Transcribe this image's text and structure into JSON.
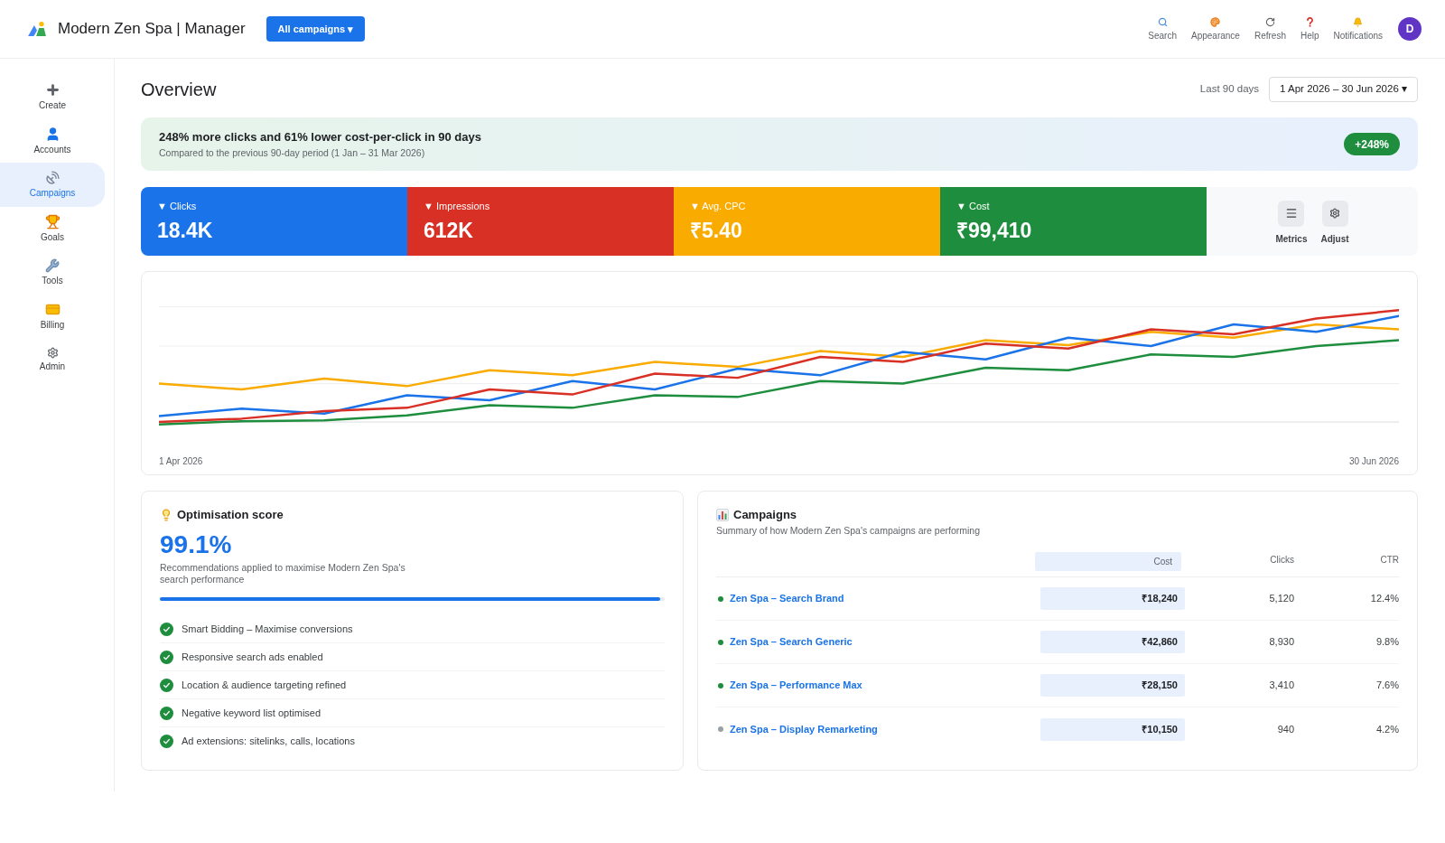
{
  "header": {
    "title": "Modern Zen Spa | Manager",
    "scope_button": "All campaigns ▾",
    "tools": [
      {
        "label": "Search"
      },
      {
        "label": "Appearance"
      },
      {
        "label": "Refresh"
      },
      {
        "label": "Help"
      },
      {
        "label": "Notifications"
      }
    ],
    "avatar": "D"
  },
  "sidebar": {
    "items": [
      {
        "label": "Create",
        "selected": false
      },
      {
        "label": "Accounts",
        "selected": false
      },
      {
        "label": "Campaigns",
        "selected": true
      },
      {
        "label": "Goals",
        "selected": false
      },
      {
        "label": "Tools",
        "selected": false
      },
      {
        "label": "Billing",
        "selected": false
      },
      {
        "label": "Admin",
        "selected": false
      }
    ]
  },
  "overview": {
    "title": "Overview",
    "range_label": "Last 90 days",
    "date_range": "1 Apr 2026 – 30 Jun 2026 ▾"
  },
  "banner": {
    "headline": "248% more clicks and 61% lower cost-per-click in 90 days",
    "subtext": "Compared to the previous 90-day period (1 Jan – 31 Mar 2026)",
    "badge": "+248%"
  },
  "metrics": [
    {
      "label": "▼ Clicks",
      "value": "18.4K",
      "color": "#1a73e8"
    },
    {
      "label": "▼ Impressions",
      "value": "612K",
      "color": "#d93025"
    },
    {
      "label": "▼ Avg. CPC",
      "value": "₹5.40",
      "color": "#f9ab00"
    },
    {
      "label": "▼ Cost",
      "value": "₹99,410",
      "color": "#1e8e3e"
    }
  ],
  "metric_actions": [
    {
      "label": "Metrics"
    },
    {
      "label": "Adjust"
    }
  ],
  "chart": {
    "start_label": "1 Apr 2026",
    "end_label": "30 Jun 2026"
  },
  "optimisation": {
    "title": "Optimisation score",
    "score": "99.1%",
    "description": "Recommendations applied to maximise Modern Zen Spa's search performance",
    "level": 0.991,
    "items": [
      {
        "label": "Smart Bidding – Maximise conversions",
        "checked": true
      },
      {
        "label": "Responsive search ads enabled",
        "checked": true
      },
      {
        "label": "Location & audience targeting refined",
        "checked": true
      },
      {
        "label": "Negative keyword list optimised",
        "checked": true
      },
      {
        "label": "Ad extensions: sitelinks, calls, locations",
        "checked": true
      }
    ]
  },
  "campaigns": {
    "title": "Campaigns",
    "subtitle": "Summary of how Modern Zen Spa's campaigns are performing",
    "columns": [
      {
        "label": "Cost",
        "selected": true
      },
      {
        "label": "Clicks",
        "selected": false
      },
      {
        "label": "CTR",
        "selected": false
      }
    ],
    "rows": [
      {
        "name": "Zen Spa – Search Brand",
        "color": "#1e8e3e",
        "cells": [
          "₹18,240",
          "5,120",
          "12.4%"
        ]
      },
      {
        "name": "Zen Spa – Search Generic",
        "color": "#1e8e3e",
        "cells": [
          "₹42,860",
          "8,930",
          "9.8%"
        ]
      },
      {
        "name": "Zen Spa – Performance Max",
        "color": "#1e8e3e",
        "cells": [
          "₹28,150",
          "3,410",
          "7.6%"
        ]
      },
      {
        "name": "Zen Spa – Display Remarketing",
        "color": "#9aa0a6",
        "cells": [
          "₹10,150",
          "940",
          "4.2%"
        ]
      }
    ]
  }
}
